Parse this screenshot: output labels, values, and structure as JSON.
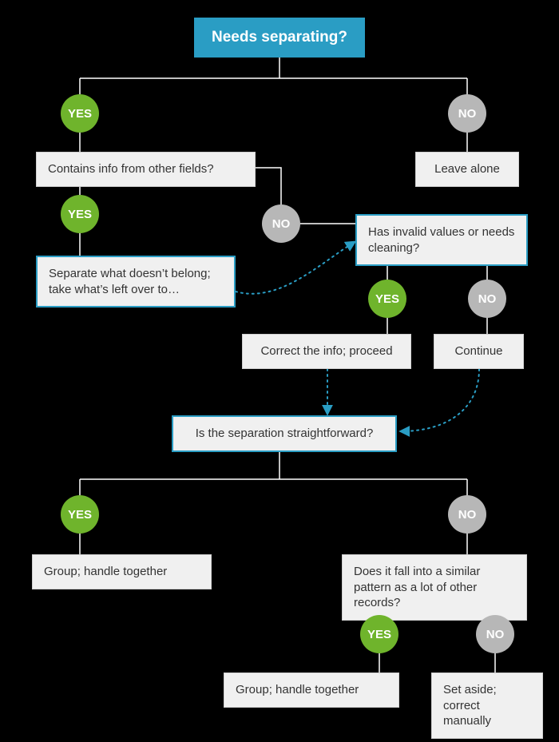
{
  "labels": {
    "yes": "YES",
    "no": "NO"
  },
  "nodes": {
    "root": "Needs separating?",
    "leave_alone": "Leave alone",
    "contains_info": "Contains info from other fields?",
    "separate_take": "Separate what doesn’t belong; take what’s left over to…",
    "has_invalid": "Has invalid values or needs cleaning?",
    "correct": "Correct the info; proceed",
    "continue": "Continue",
    "is_straightforward": "Is the separation straightforward?",
    "group1": "Group; handle together",
    "similar_pattern": "Does it fall into a similar pattern as a lot of other records?",
    "group2": "Group; handle together",
    "set_aside": "Set aside; correct manually"
  },
  "colors": {
    "accent": "#2a9dc4",
    "yes_green": "#6fb42c",
    "no_grey": "#b7b7b7",
    "bg": "#000000",
    "box_bg": "#f0f0f0"
  }
}
